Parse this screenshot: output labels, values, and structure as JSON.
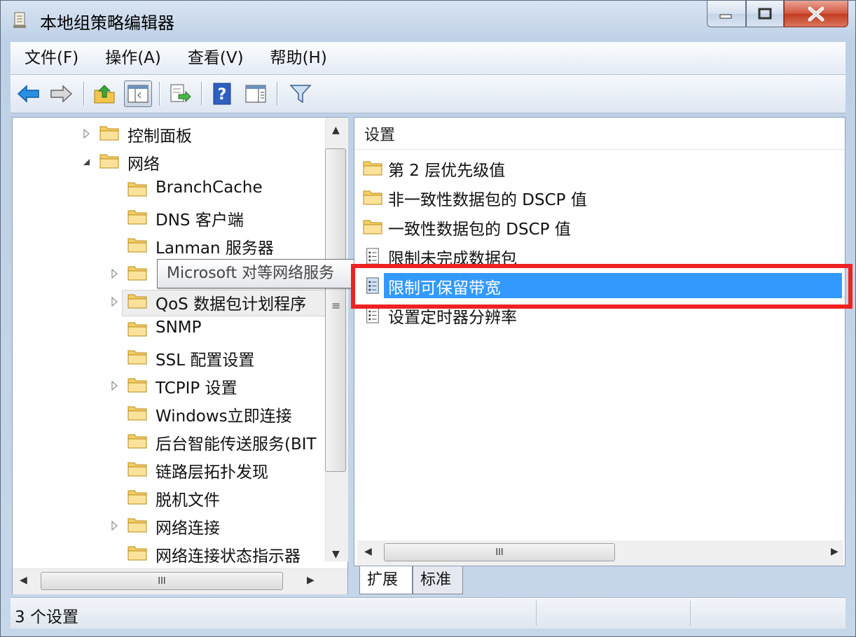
{
  "window": {
    "title": "本地组策略编辑器"
  },
  "menu": [
    "文件(F)",
    "操作(A)",
    "查看(V)",
    "帮助(H)"
  ],
  "toolbar": {
    "buttons": [
      "back-icon",
      "forward-icon",
      "up-folder-icon",
      "show-hide-tree-icon",
      "export-list-icon",
      "help-icon",
      "action-pane-icon",
      "filter-icon"
    ]
  },
  "tree": {
    "items": [
      {
        "label": "控制面板",
        "level": 1,
        "expander": "collapsed"
      },
      {
        "label": "网络",
        "level": 1,
        "expander": "expanded"
      },
      {
        "label": "BranchCache",
        "level": 2,
        "expander": "none"
      },
      {
        "label": "DNS 客户端",
        "level": 2,
        "expander": "none"
      },
      {
        "label": "Lanman 服务器",
        "level": 2,
        "expander": "none"
      },
      {
        "label": "",
        "level": 2,
        "expander": "collapsed"
      },
      {
        "label": "QoS 数据包计划程序",
        "level": 2,
        "expander": "collapsed"
      },
      {
        "label": "SNMP",
        "level": 2,
        "expander": "none"
      },
      {
        "label": "SSL 配置设置",
        "level": 2,
        "expander": "none"
      },
      {
        "label": "TCPIP 设置",
        "level": 2,
        "expander": "collapsed"
      },
      {
        "label": "Windows立即连接",
        "level": 2,
        "expander": "none"
      },
      {
        "label": "后台智能传送服务(BIT",
        "level": 2,
        "expander": "none"
      },
      {
        "label": "链路层拓扑发现",
        "level": 2,
        "expander": "none"
      },
      {
        "label": "脱机文件",
        "level": 2,
        "expander": "none"
      },
      {
        "label": "网络连接",
        "level": 2,
        "expander": "collapsed"
      },
      {
        "label": "网络连接状态指示器",
        "level": 2,
        "expander": "none"
      }
    ],
    "tooltip": "Microsoft 对等网络服务",
    "hscroll_label": "III",
    "vscroll_label": "≡"
  },
  "list": {
    "header": "设置",
    "items": [
      {
        "label": "第 2 层优先级值",
        "icon": "folder-icon"
      },
      {
        "label": "非一致性数据包的 DSCP 值",
        "icon": "folder-icon"
      },
      {
        "label": "一致性数据包的 DSCP 值",
        "icon": "folder-icon"
      },
      {
        "label": "限制未完成数据包",
        "icon": "policy-setting-icon"
      },
      {
        "label": "限制可保留带宽",
        "icon": "policy-setting-icon",
        "selected": true
      },
      {
        "label": "设置定时器分辨率",
        "icon": "policy-setting-icon"
      }
    ],
    "hscroll_label": "III"
  },
  "tabs": [
    "扩展",
    "标准"
  ],
  "status": {
    "text": "3 个设置"
  },
  "colors": {
    "selection": "#3399ff",
    "highlight_box": "#ee2222"
  }
}
